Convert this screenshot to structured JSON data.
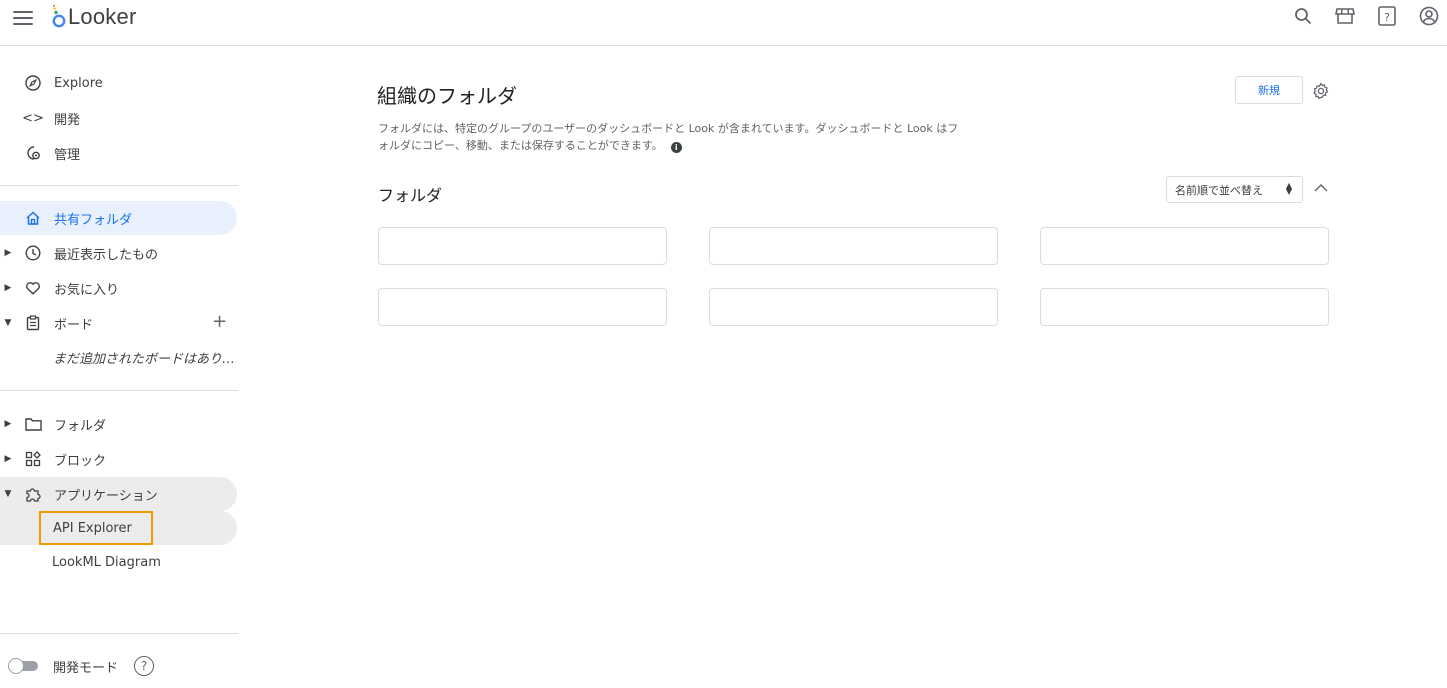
{
  "app": {
    "name": "Looker"
  },
  "sidebar": {
    "primary": [
      {
        "label": "Explore",
        "icon": "compass-icon"
      },
      {
        "label": "開発",
        "icon": "code-icon"
      },
      {
        "label": "管理",
        "icon": "admin-icon"
      }
    ],
    "shared_folders": "共有フォルダ",
    "recent": "最近表示したもの",
    "favorites": "お気に入り",
    "boards": "ボード",
    "boards_empty": "まだ追加されたボードはあり…",
    "folders": "フォルダ",
    "blocks": "ブロック",
    "applications": "アプリケーション",
    "app_items": [
      "API Explorer",
      "LookML Diagram"
    ],
    "dev_mode": "開発モード",
    "dev_mode_on": false
  },
  "main": {
    "title": "組織のフォルダ",
    "new_button": "新規",
    "description_line1": "フォルダには、特定のグループのユーザーのダッシュボードと Look が含まれています。ダッシュボードと Look はフ",
    "description_line2": "ォルダにコピー、移動、または保存することができます。",
    "info_glyph": "i",
    "section_title": "フォルダ",
    "sort_label": "名前順で並べ替え",
    "folder_cards": [
      "",
      "",
      "",
      "",
      "",
      ""
    ]
  },
  "colors": {
    "accent": "#1a73e8",
    "highlight_outline": "#f29900",
    "selected_bg": "#e8f0fe"
  }
}
